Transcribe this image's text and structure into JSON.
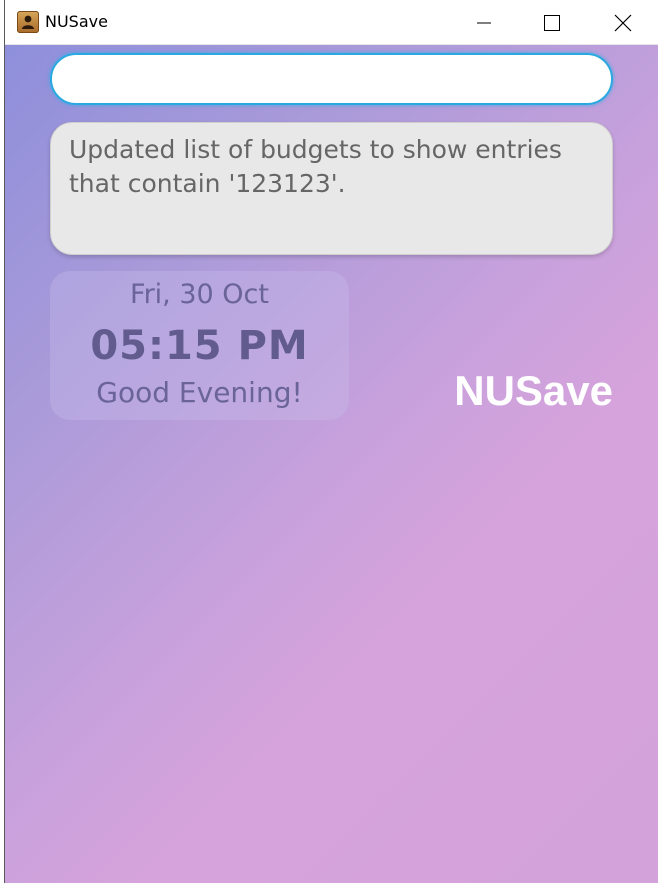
{
  "window": {
    "title": "NUSave",
    "controls": {
      "minimize_icon": "minimize-icon",
      "maximize_icon": "maximize-icon",
      "close_icon": "close-icon"
    }
  },
  "command": {
    "value": "",
    "placeholder": ""
  },
  "result": {
    "message": "Updated list of budgets to show entries that contain '123123'."
  },
  "clock": {
    "date": "Fri, 30 Oct",
    "time": "05:15 PM",
    "greeting": "Good Evening!"
  },
  "brand": {
    "name": "NUSave"
  },
  "colors": {
    "accent_border": "#2aa9e0",
    "gradient_start": "#8e8fdb",
    "gradient_end": "#d6a3dc",
    "clock_text": "#625b8e"
  }
}
